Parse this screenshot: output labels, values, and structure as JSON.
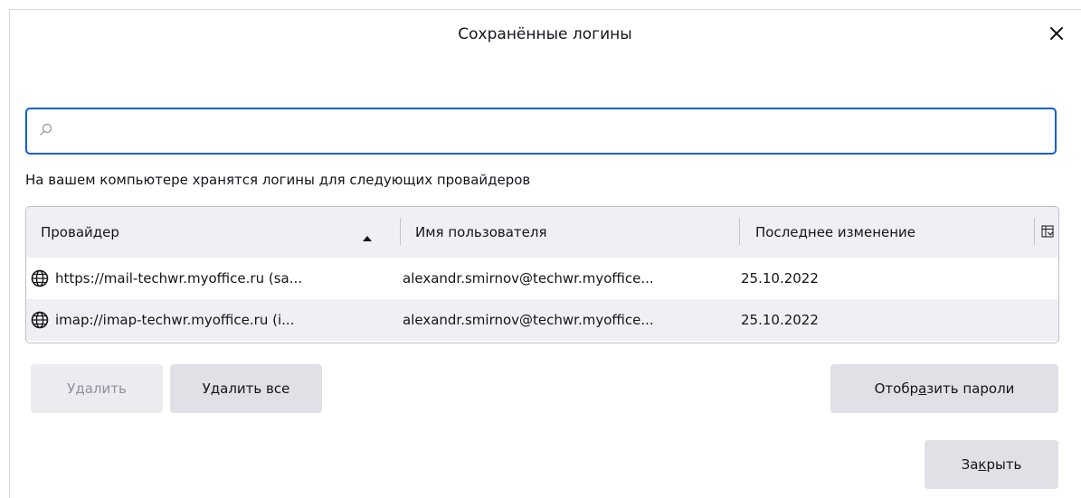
{
  "dialog": {
    "title": "Сохранённые логины"
  },
  "search": {
    "value": "",
    "placeholder": ""
  },
  "intro_text": "На вашем компьютере хранятся логины для следующих провайдеров",
  "table": {
    "columns": [
      "Провайдер",
      "Имя пользователя",
      "Последнее изменение"
    ],
    "sort_column": "Провайдер",
    "sort_direction": "ascending",
    "rows": [
      {
        "provider": "https://mail-techwr.myoffice.ru (sa...",
        "username": "alexandr.smirnov@techwr.myoffice...",
        "modified": "25.10.2022"
      },
      {
        "provider": "imap://imap-techwr.myoffice.ru (i...",
        "username": "alexandr.smirnov@techwr.myoffice...",
        "modified": "25.10.2022"
      }
    ]
  },
  "buttons": {
    "remove": {
      "pre": "У",
      "key": "д",
      "post": "алить",
      "enabled": false
    },
    "remove_all": {
      "pre": "У",
      "key": "д",
      "post": "алить все"
    },
    "show_passwords": {
      "pre": "Отобр",
      "key": "а",
      "post": "зить пароли"
    },
    "close": {
      "pre": "За",
      "key": "к",
      "post": "рыть"
    }
  },
  "colors": {
    "accent": "#0a5fcf",
    "header_bg": "#f0f0f4",
    "button_bg": "#e0e0e6"
  }
}
